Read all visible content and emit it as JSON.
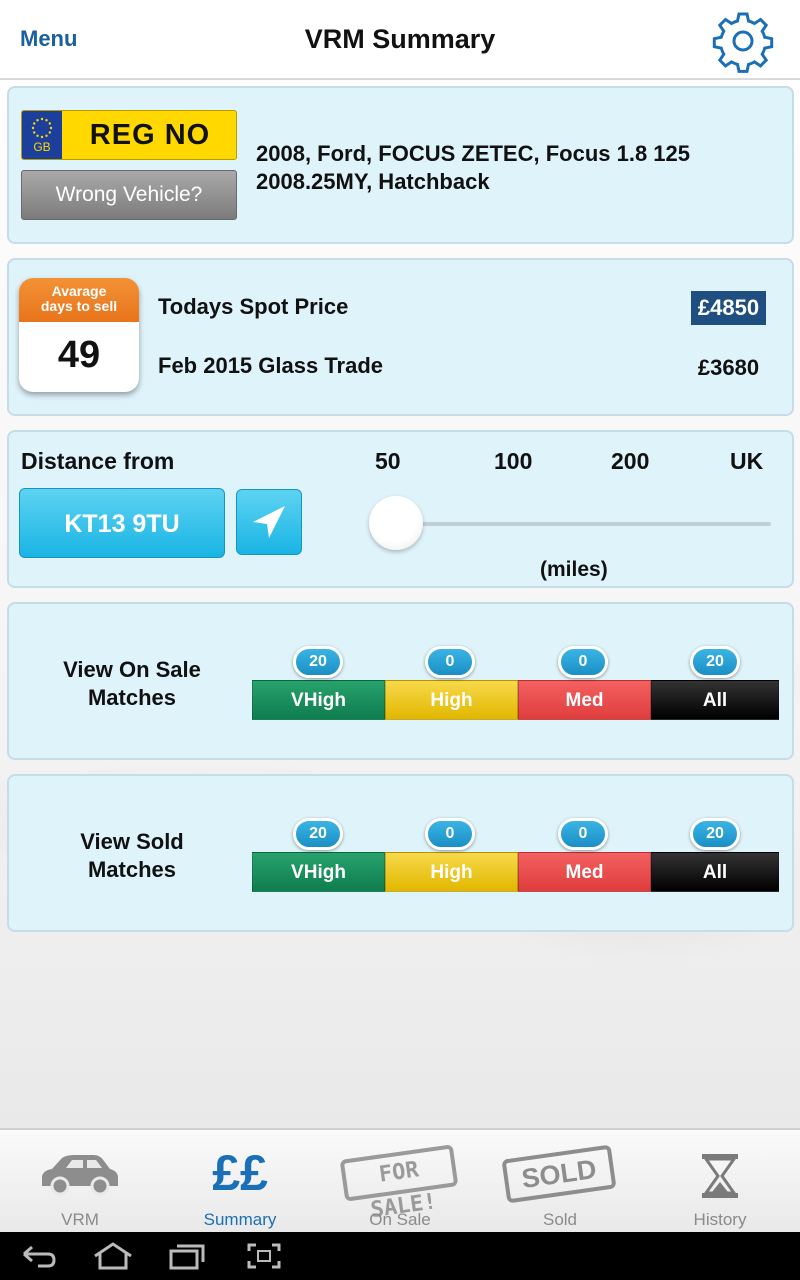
{
  "header": {
    "menu_label": "Menu",
    "title": "VRM Summary",
    "settings_icon": "gear-icon"
  },
  "vehicle": {
    "plate_country": "GB",
    "plate_text": "REG NO",
    "wrong_vehicle_label": "Wrong Vehicle?",
    "description_line1": "2008, Ford, FOCUS ZETEC, Focus 1.8 125",
    "description_line2": "2008.25MY, Hatchback"
  },
  "pricing": {
    "calendar_label_line1": "Avarage",
    "calendar_label_line2": "days to sell",
    "days_to_sell": "49",
    "spot_price_label": "Todays Spot Price",
    "spot_price_value": "£4850",
    "glass_trade_label": "Feb 2015 Glass Trade",
    "glass_trade_value": "£3680"
  },
  "distance": {
    "label": "Distance from",
    "postcode": "KT13 9TU",
    "locate_icon": "location-arrow-icon",
    "ticks": [
      "50",
      "100",
      "200",
      "UK"
    ],
    "selected_tick": "50",
    "unit": "(miles)"
  },
  "on_sale_matches": {
    "title_line1": "View On Sale",
    "title_line2": "Matches",
    "segments": [
      {
        "label": "VHigh",
        "count": "20"
      },
      {
        "label": "High",
        "count": "0"
      },
      {
        "label": "Med",
        "count": "0"
      },
      {
        "label": "All",
        "count": "20"
      }
    ]
  },
  "sold_matches": {
    "title_line1": "View Sold",
    "title_line2": "Matches",
    "segments": [
      {
        "label": "VHigh",
        "count": "20"
      },
      {
        "label": "High",
        "count": "0"
      },
      {
        "label": "Med",
        "count": "0"
      },
      {
        "label": "All",
        "count": "20"
      }
    ]
  },
  "tabs": [
    {
      "label": "VRM",
      "icon": "car-icon",
      "active": false
    },
    {
      "label": "Summary",
      "icon": "pounds-icon",
      "icon_text": "££",
      "active": true
    },
    {
      "label": "On Sale",
      "icon": "for-sale-stamp-icon",
      "icon_text": "FOR SALE!",
      "active": false
    },
    {
      "label": "Sold",
      "icon": "sold-stamp-icon",
      "icon_text": "SOLD",
      "active": false
    },
    {
      "label": "History",
      "icon": "hourglass-icon",
      "active": false
    }
  ],
  "colors": {
    "accent_blue": "#1a6fb6",
    "card_bg": "#dff3fb",
    "vhigh": "#0f7d4f",
    "high": "#e2b700",
    "med": "#df3d3d",
    "all": "#000000",
    "calendar_orange": "#e8741b"
  },
  "system_nav": [
    "back-icon",
    "home-icon",
    "recent-apps-icon",
    "screenshot-icon"
  ]
}
